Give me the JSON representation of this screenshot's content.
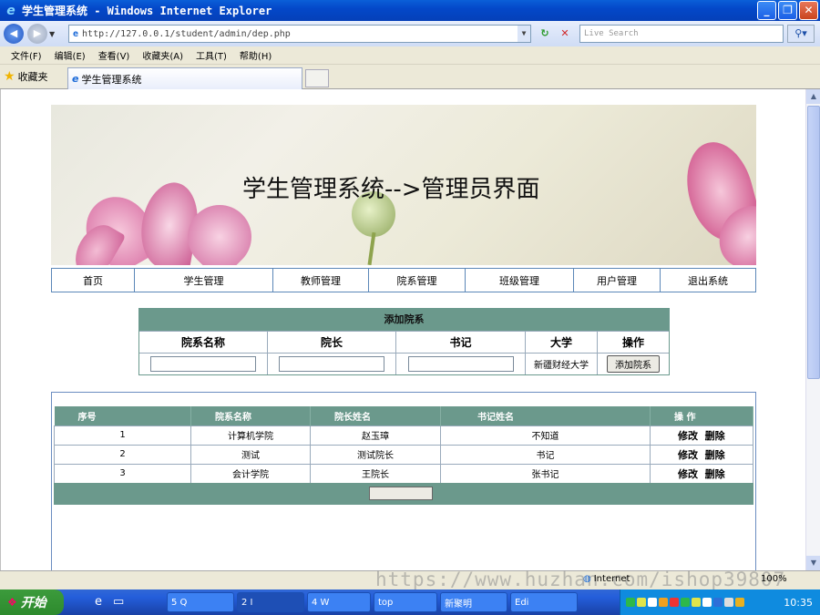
{
  "window": {
    "title": "学生管理系统 - Windows Internet Explorer"
  },
  "address": {
    "url": "http://127.0.0.1/student/admin/dep.php",
    "search_placeholder": "Live Search"
  },
  "menu": [
    "文件(F)",
    "编辑(E)",
    "查看(V)",
    "收藏夹(A)",
    "工具(T)",
    "帮助(H)"
  ],
  "favorites_label": "收藏夹",
  "tab": {
    "label": "学生管理系统"
  },
  "banner": {
    "title": "学生管理系统-->管理员界面"
  },
  "nav": [
    "首页",
    "学生管理",
    "教师管理",
    "院系管理",
    "班级管理",
    "用户管理",
    "退出系统"
  ],
  "add_form": {
    "heading": "添加院系",
    "columns": [
      "院系名称",
      "院长",
      "书记",
      "大学",
      "操作"
    ],
    "university_value": "新疆财经大学",
    "submit_label": "添加院系"
  },
  "list": {
    "headers": [
      "序号",
      "院系名称",
      "院长姓名",
      "书记姓名",
      "操 作"
    ],
    "rows": [
      {
        "no": "1",
        "name": "计算机学院",
        "dean": "赵玉璋",
        "secretary": "不知道"
      },
      {
        "no": "2",
        "name": "测试",
        "dean": "测试院长",
        "secretary": "书记"
      },
      {
        "no": "3",
        "name": "会计学院",
        "dean": "王院长",
        "secretary": "张书记"
      }
    ],
    "edit_label": "修改",
    "delete_label": "删除"
  },
  "status": {
    "zone": "Internet",
    "zoom": "100%",
    "watermark": "https://www.huzhan.com/ishop39807"
  },
  "taskbar": {
    "start_label": "开始",
    "buttons": [
      "5 Q",
      "2 I",
      "4 W",
      "top",
      "新聚明",
      "Edi"
    ],
    "clock": "10:35"
  }
}
